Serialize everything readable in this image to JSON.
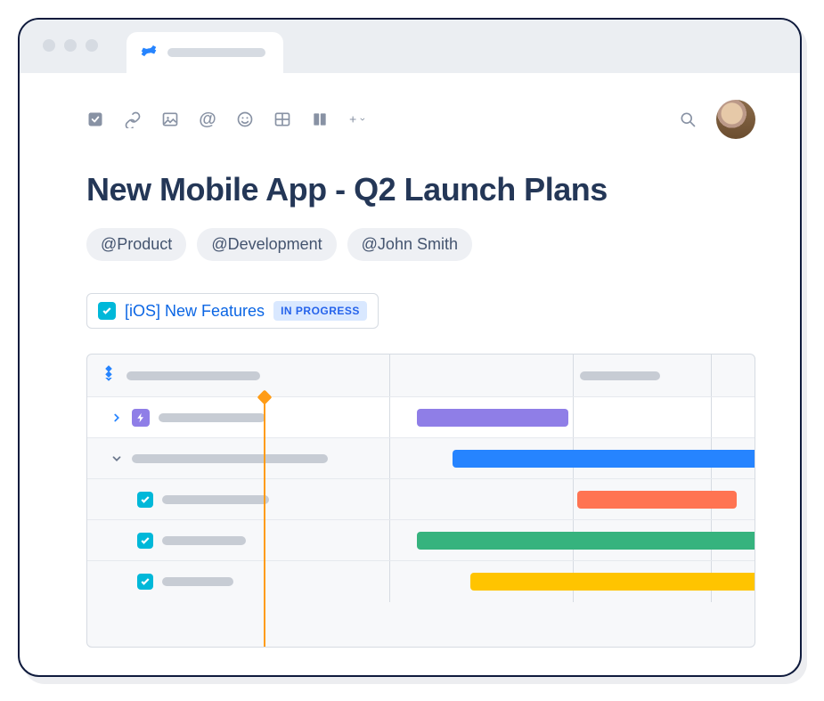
{
  "page": {
    "title": "New Mobile App - Q2 Launch Plans"
  },
  "mentions": [
    "@Product",
    "@Development",
    "@John Smith"
  ],
  "task": {
    "title": "[iOS] New Features",
    "status": "IN PROGRESS"
  },
  "gantt": {
    "bars": [
      {
        "color": "purple"
      },
      {
        "color": "blue"
      },
      {
        "color": "orange"
      },
      {
        "color": "green"
      },
      {
        "color": "yellow"
      }
    ]
  }
}
